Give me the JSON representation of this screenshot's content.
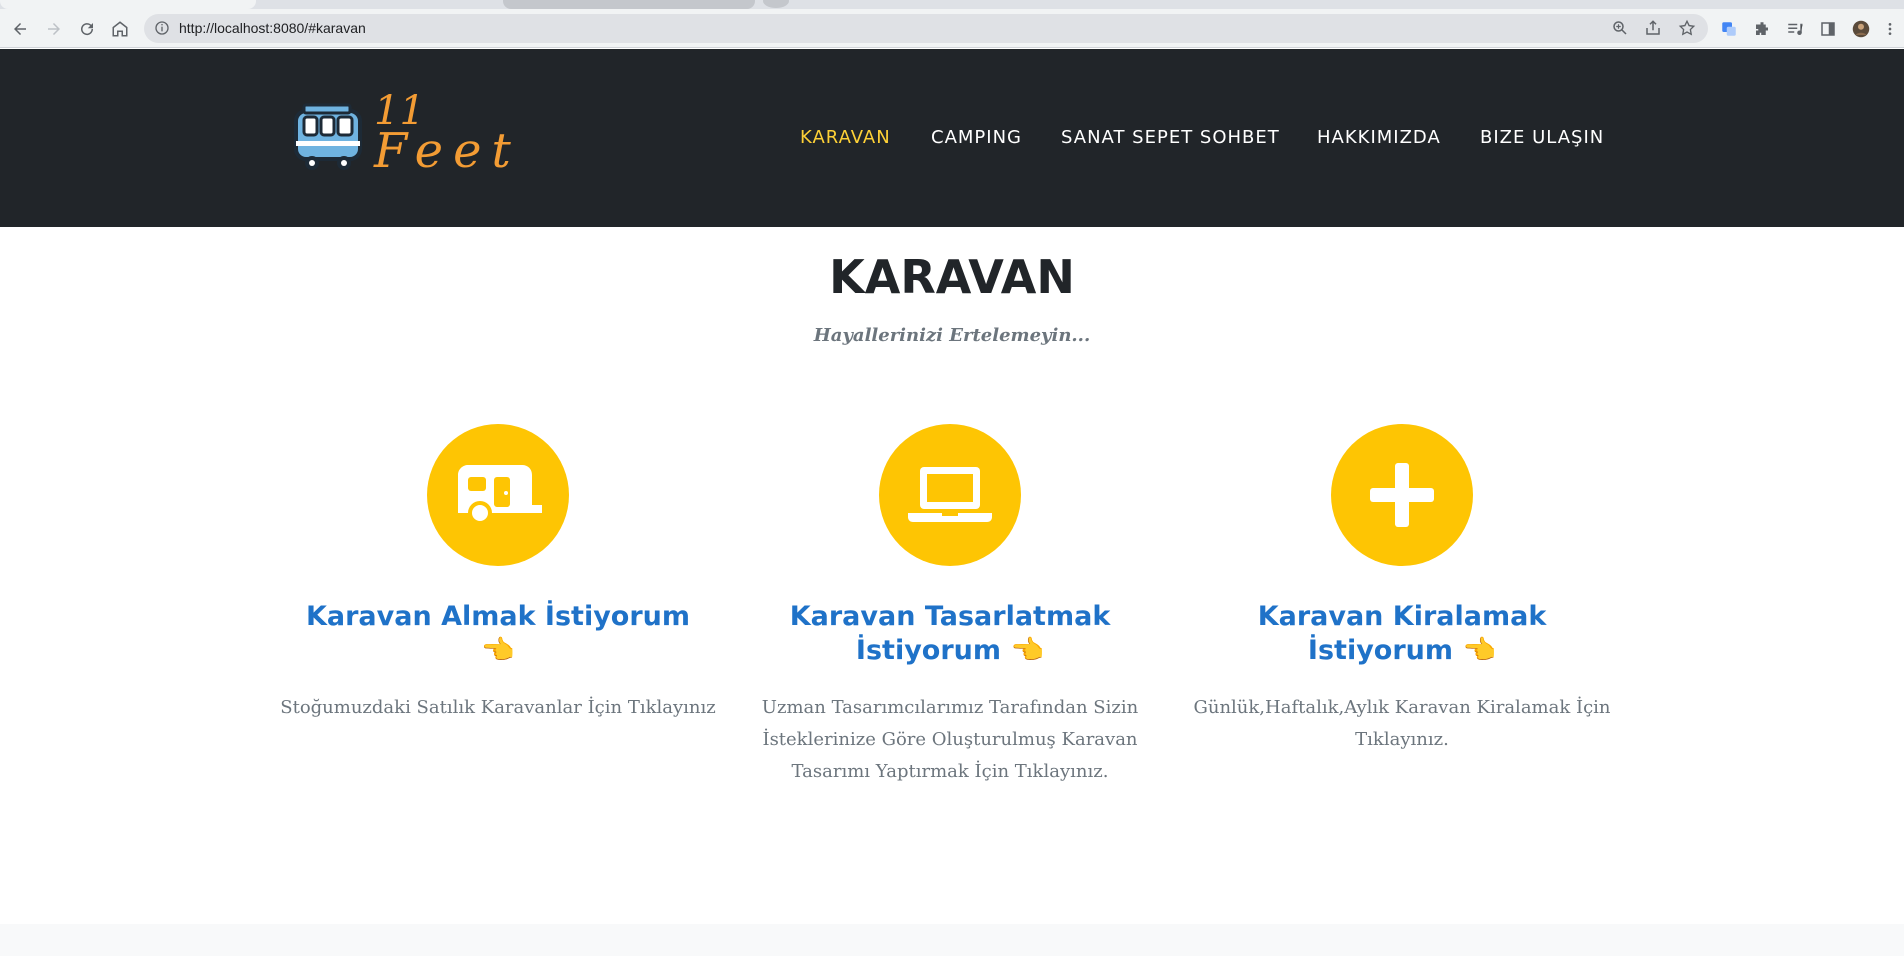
{
  "browser": {
    "url": "http://localhost:8080/#karavan"
  },
  "header": {
    "logo_line1": "11",
    "logo_line2": "Feet",
    "nav": [
      {
        "label": "KARAVAN"
      },
      {
        "label": "CAMPING"
      },
      {
        "label": "SANAT SEPET SOHBET"
      },
      {
        "label": "HAKKIMIZDA"
      },
      {
        "label": "BIZE ULAŞIN"
      }
    ]
  },
  "section": {
    "title": "KARAVAN",
    "subtitle": "Hayallerinizi Ertelemeyin..."
  },
  "services": [
    {
      "icon": "caravan-icon",
      "heading": "Karavan Almak İstiyorum",
      "pointer": "👈",
      "text": "Stoğumuzdaki Satılık Karavanlar İçin Tıklayınız"
    },
    {
      "icon": "laptop-icon",
      "heading_line1": "Karavan Tasarlatmak",
      "heading_line2": "İstiyorum",
      "pointer": "👈",
      "text": "Uzman Tasarımcılarımız Tarafından Sizin İsteklerinize Göre Oluşturulmuş Karavan Tasarımı Yaptırmak İçin Tıklayınız."
    },
    {
      "icon": "plus-icon",
      "heading_line1": "Karavan Kiralamak",
      "heading_line2": "İstiyorum",
      "pointer": "👈",
      "text": "Günlük,Haftalık,Aylık Karavan Kiralamak İçin Tıklayınız."
    }
  ],
  "colors": {
    "header_bg": "#212529",
    "accent_yellow": "#fec503",
    "nav_active": "#fed136",
    "heading_blue": "#1f72c8",
    "logo_orange": "#f39c34"
  }
}
